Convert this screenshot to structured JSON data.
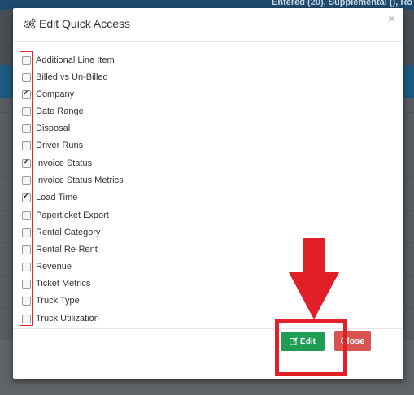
{
  "background": {
    "topbar_text": "Entered (20), Supplemental (), Ro"
  },
  "modal": {
    "title": "Edit Quick Access",
    "close_symbol": "×",
    "items": [
      {
        "label": "Additional Line Item",
        "checked": false
      },
      {
        "label": "Billed vs Un-Billed",
        "checked": false
      },
      {
        "label": "Company",
        "checked": true
      },
      {
        "label": "Date Range",
        "checked": false
      },
      {
        "label": "Disposal",
        "checked": false
      },
      {
        "label": "Driver Runs",
        "checked": false
      },
      {
        "label": "Invoice Status",
        "checked": true
      },
      {
        "label": "Invoice Status Metrics",
        "checked": false
      },
      {
        "label": "Load Time",
        "checked": true
      },
      {
        "label": "Paperticket Export",
        "checked": false
      },
      {
        "label": "Rental Category",
        "checked": false
      },
      {
        "label": "Rental Re-Rent",
        "checked": false
      },
      {
        "label": "Revenue",
        "checked": false
      },
      {
        "label": "Ticket Metrics",
        "checked": false
      },
      {
        "label": "Truck Type",
        "checked": false
      },
      {
        "label": "Truck Utilization",
        "checked": false
      }
    ],
    "edit_button_label": "Edit",
    "close_button_label": "Close"
  },
  "colors": {
    "edit_button": "#1f9d55",
    "close_button": "#d9534f",
    "annotation_red": "#e21e26"
  },
  "icons": {
    "title_icon": "cogs-icon",
    "edit_icon": "pencil-square-icon",
    "annotation_arrow": "down-arrow-icon"
  }
}
